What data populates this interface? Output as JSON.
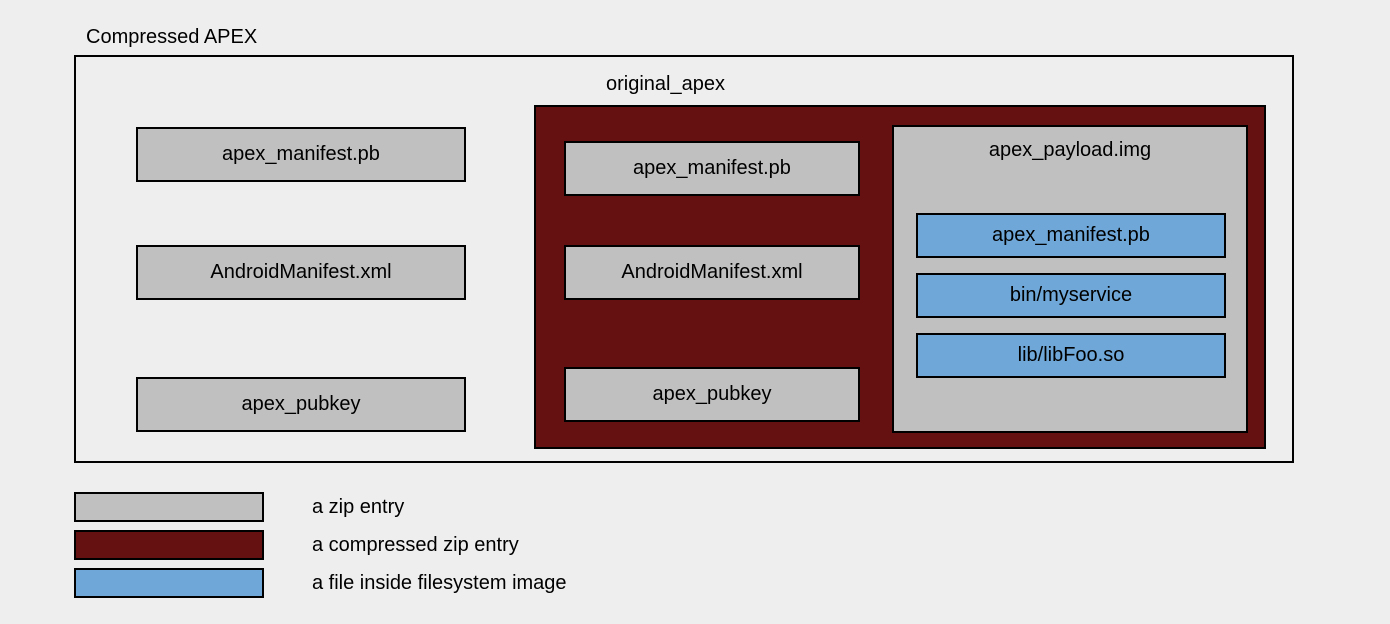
{
  "outer": {
    "title": "Compressed APEX",
    "left_boxes": [
      "apex_manifest.pb",
      "AndroidManifest.xml",
      "apex_pubkey"
    ]
  },
  "original": {
    "title": "original_apex",
    "mid_boxes": [
      "apex_manifest.pb",
      "AndroidManifest.xml",
      "apex_pubkey"
    ],
    "payload": {
      "title": "apex_payload.img",
      "files": [
        "apex_manifest.pb",
        "bin/myservice",
        "lib/libFoo.so"
      ]
    }
  },
  "legend": {
    "items": [
      {
        "swatch": "grey",
        "label": "a zip entry"
      },
      {
        "swatch": "red",
        "label": "a compressed zip entry"
      },
      {
        "swatch": "blue",
        "label": "a file inside filesystem image"
      }
    ]
  },
  "colors": {
    "grey": "#c0c0c0",
    "red": "#661111",
    "blue": "#6fa8d8",
    "bg": "#eeeeee"
  }
}
